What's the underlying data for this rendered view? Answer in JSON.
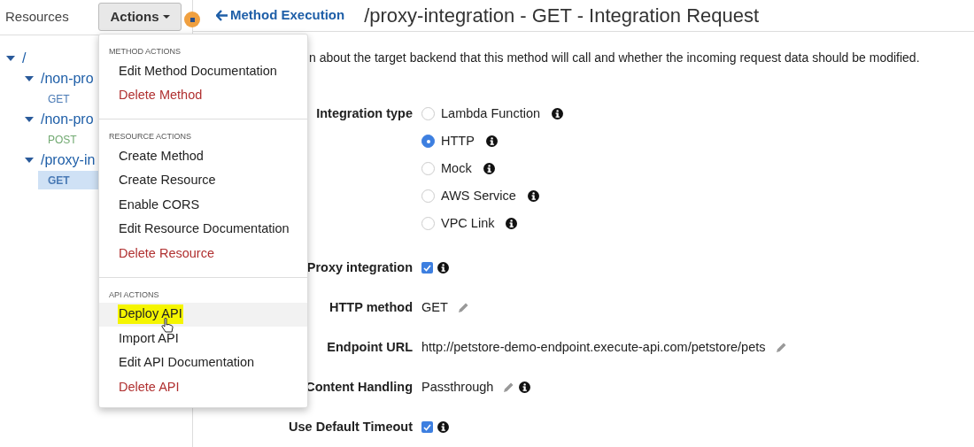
{
  "sidebar": {
    "title": "Resources",
    "tree": [
      {
        "label": "/",
        "expanded": true,
        "children": [
          {
            "label": "/non-pro",
            "expanded": true,
            "children": [
              {
                "label": "GET",
                "kind": "method",
                "color": "#4a7ab5",
                "selected": false
              }
            ]
          },
          {
            "label": "/non-pro",
            "expanded": true,
            "children": [
              {
                "label": "POST",
                "kind": "method",
                "color": "#72aa72",
                "selected": false
              }
            ]
          },
          {
            "label": "/proxy-in",
            "expanded": true,
            "children": [
              {
                "label": "GET",
                "kind": "method",
                "color": "#4a7ab5",
                "selected": true
              }
            ]
          }
        ]
      }
    ]
  },
  "actions_button": {
    "label": "Actions"
  },
  "actions_menu": {
    "sections": [
      {
        "header": "METHOD ACTIONS",
        "items": [
          {
            "label": "Edit Method Documentation",
            "danger": false,
            "hovered": false,
            "highlighted": false
          },
          {
            "label": "Delete Method",
            "danger": true,
            "hovered": false,
            "highlighted": false
          }
        ]
      },
      {
        "header": "RESOURCE ACTIONS",
        "items": [
          {
            "label": "Create Method",
            "danger": false,
            "hovered": false,
            "highlighted": false
          },
          {
            "label": "Create Resource",
            "danger": false,
            "hovered": false,
            "highlighted": false
          },
          {
            "label": "Enable CORS",
            "danger": false,
            "hovered": false,
            "highlighted": false
          },
          {
            "label": "Edit Resource Documentation",
            "danger": false,
            "hovered": false,
            "highlighted": false
          },
          {
            "label": "Delete Resource",
            "danger": true,
            "hovered": false,
            "highlighted": false
          }
        ]
      },
      {
        "header": "API ACTIONS",
        "items": [
          {
            "label": "Deploy API",
            "danger": false,
            "hovered": true,
            "highlighted": true
          },
          {
            "label": "Import API",
            "danger": false,
            "hovered": false,
            "highlighted": false
          },
          {
            "label": "Edit API Documentation",
            "danger": false,
            "hovered": false,
            "highlighted": false
          },
          {
            "label": "Delete API",
            "danger": true,
            "hovered": false,
            "highlighted": false
          }
        ]
      }
    ]
  },
  "back_link": "Method Execution",
  "page_title": "/proxy-integration - GET - Integration Request",
  "description": "n about the target backend that this method will call and whether the incoming request data should be modified.",
  "form": [
    {
      "kind": "radio",
      "label": "Integration type",
      "options": [
        {
          "label": "Lambda Function",
          "selected": false,
          "info": true
        },
        {
          "label": "HTTP",
          "selected": true,
          "info": true
        },
        {
          "label": "Mock",
          "selected": false,
          "info": true
        },
        {
          "label": "AWS Service",
          "selected": false,
          "info": true
        },
        {
          "label": "VPC Link",
          "selected": false,
          "info": true
        }
      ]
    },
    {
      "kind": "checkbox",
      "label": "Proxy integration",
      "checked": true,
      "info": true
    },
    {
      "kind": "text",
      "label": "HTTP method",
      "value": "GET",
      "editable": true
    },
    {
      "kind": "text",
      "label": "Endpoint URL",
      "value": "http://petstore-demo-endpoint.execute-api.com/petstore/pets",
      "editable": true
    },
    {
      "kind": "text",
      "label": "Content Handling",
      "value": "Passthrough",
      "editable": true,
      "info": true
    },
    {
      "kind": "checkbox",
      "label": "Use Default Timeout",
      "checked": true,
      "info": true
    }
  ]
}
